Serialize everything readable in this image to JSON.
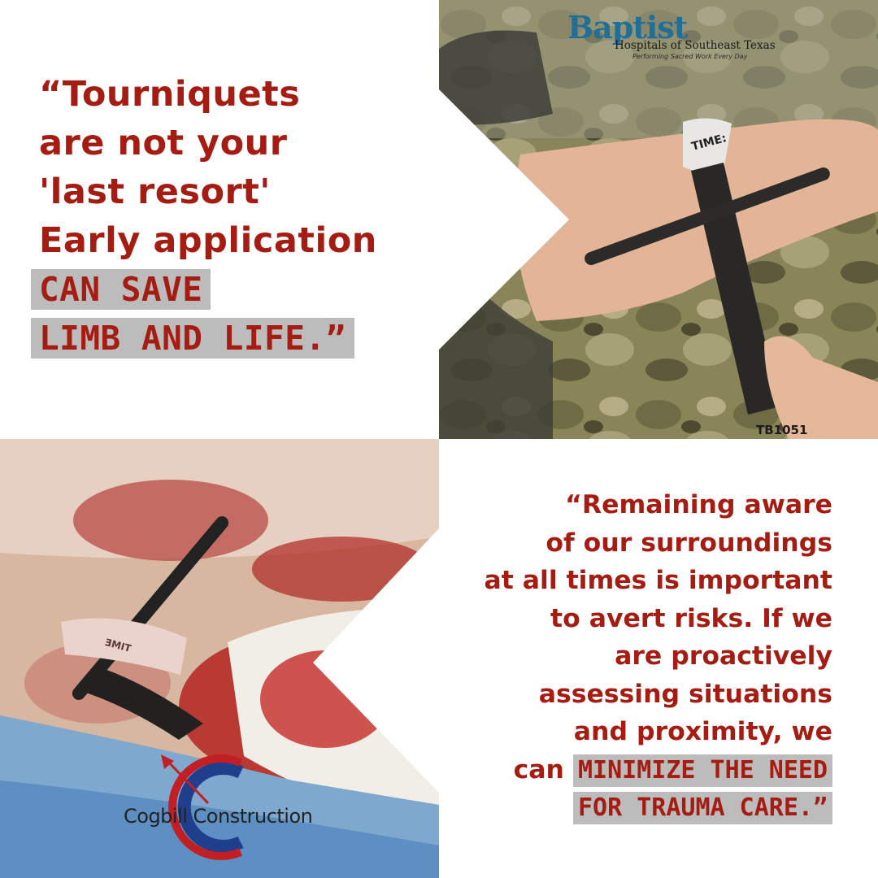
{
  "quote_top": {
    "lines": [
      "“Tourniquets",
      "are not your",
      "'last resort'",
      "Early application"
    ],
    "highlight": [
      "CAN SAVE",
      "LIMB AND LIFE.”"
    ]
  },
  "quote_bottom": {
    "lines": [
      "“Remaining aware",
      "of our surroundings",
      "at all times is important",
      "to avert risks. If we",
      "are proactively",
      "assessing situations",
      "and proximity, we"
    ],
    "lead": "can",
    "highlight": [
      "MINIMIZE THE NEED",
      "FOR TRAUMA CARE.”"
    ]
  },
  "logos": {
    "baptist": {
      "name": "Baptist",
      "subtitle": "Hospitals of Southeast Texas",
      "tagline": "Performing Sacred Work Every Day"
    },
    "cogbill": {
      "name": "Cogbill Construction"
    }
  },
  "photo_code": "TB1051",
  "colors": {
    "quote_red": "#a51c12",
    "highlight_gray": "#bdbcbc",
    "baptist_blue": "#1f6f99"
  }
}
